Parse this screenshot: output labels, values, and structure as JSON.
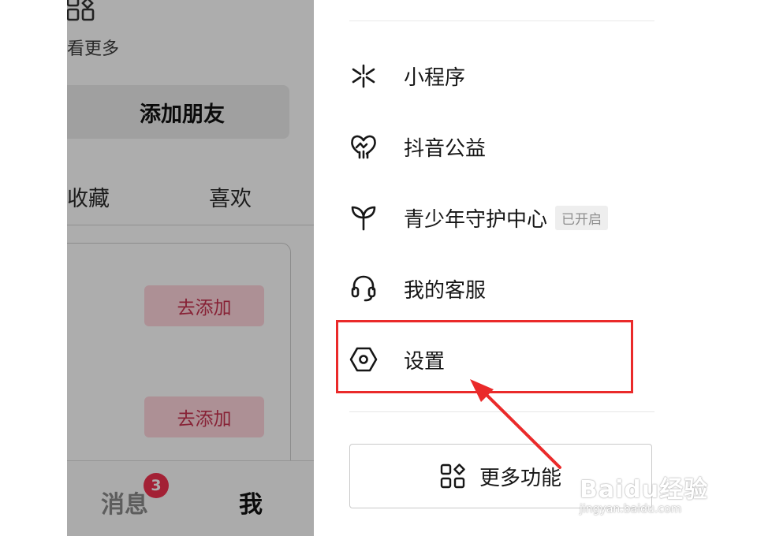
{
  "background_page": {
    "more_text": "看更多",
    "add_friend_label": "添加朋友",
    "tabs": [
      "收藏",
      "喜欢"
    ],
    "add_button_label": "去添加",
    "bottom_nav": {
      "messages_label": "消息",
      "messages_badge": "3",
      "me_label": "我"
    }
  },
  "drawer": {
    "menu_items": [
      {
        "label": "小程序",
        "icon": "mini-program-icon"
      },
      {
        "label": "抖音公益",
        "icon": "charity-heart-icon"
      },
      {
        "label": "青少年守护中心",
        "icon": "sprout-icon",
        "badge": "已开启"
      },
      {
        "label": "我的客服",
        "icon": "headset-icon"
      },
      {
        "label": "设置",
        "icon": "settings-hexagon-icon"
      }
    ],
    "more_features_label": "更多功能"
  },
  "annotation": {
    "highlight_color": "#ea2a2a"
  },
  "watermark": {
    "logo": "Baidu经验",
    "url": "jingyan.baidu.com"
  }
}
